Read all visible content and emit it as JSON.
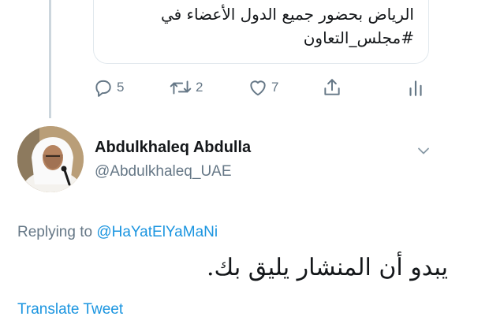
{
  "quoted_tweet": {
    "lines": [
      "الرياض بحضور جميع الدول الأعضاء في",
      "#مجلس_التعاون"
    ]
  },
  "actions": {
    "reply_count": "5",
    "retweet_count": "2",
    "like_count": "7"
  },
  "icons": {
    "reply": "reply-icon",
    "retweet": "retweet-icon",
    "like": "heart-icon",
    "share": "share-icon",
    "stats": "analytics-icon",
    "more": "chevron-down-icon"
  },
  "author": {
    "name": "Abdulkhaleq Abdulla",
    "handle": "@Abdulkhaleq_UAE"
  },
  "replying": {
    "prefix": "Replying to ",
    "mention": "@HaYatElYaMaNi"
  },
  "tweet": {
    "text": "يبدو أن المنشار يليق بك."
  },
  "translate_label": "Translate Tweet",
  "colors": {
    "accent": "#1b95e0",
    "secondary_text": "#657786",
    "primary_text": "#14171a",
    "border": "#e1e8ed"
  }
}
